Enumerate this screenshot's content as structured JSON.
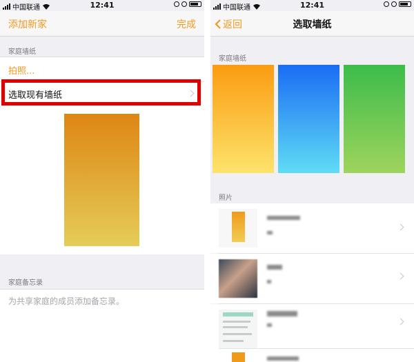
{
  "status_bar": {
    "carrier": "中国联通",
    "time": "12:41"
  },
  "left": {
    "nav": {
      "cancel": "添加新家",
      "done": "完成"
    },
    "wallpaper_section": "家庭墙纸",
    "take_photo": "拍照...",
    "choose_existing": "选取现有墙纸",
    "notes_section": "家庭备忘录",
    "notes_placeholder": "为共享家庭的成员添加备忘录。"
  },
  "right": {
    "nav": {
      "back": "返回",
      "title": "选取墙纸"
    },
    "wallpaper_section": "家庭墙纸",
    "photos_section": "照片"
  },
  "colors": {
    "accent": "#f29a1f",
    "highlight_box": "#e00000"
  }
}
